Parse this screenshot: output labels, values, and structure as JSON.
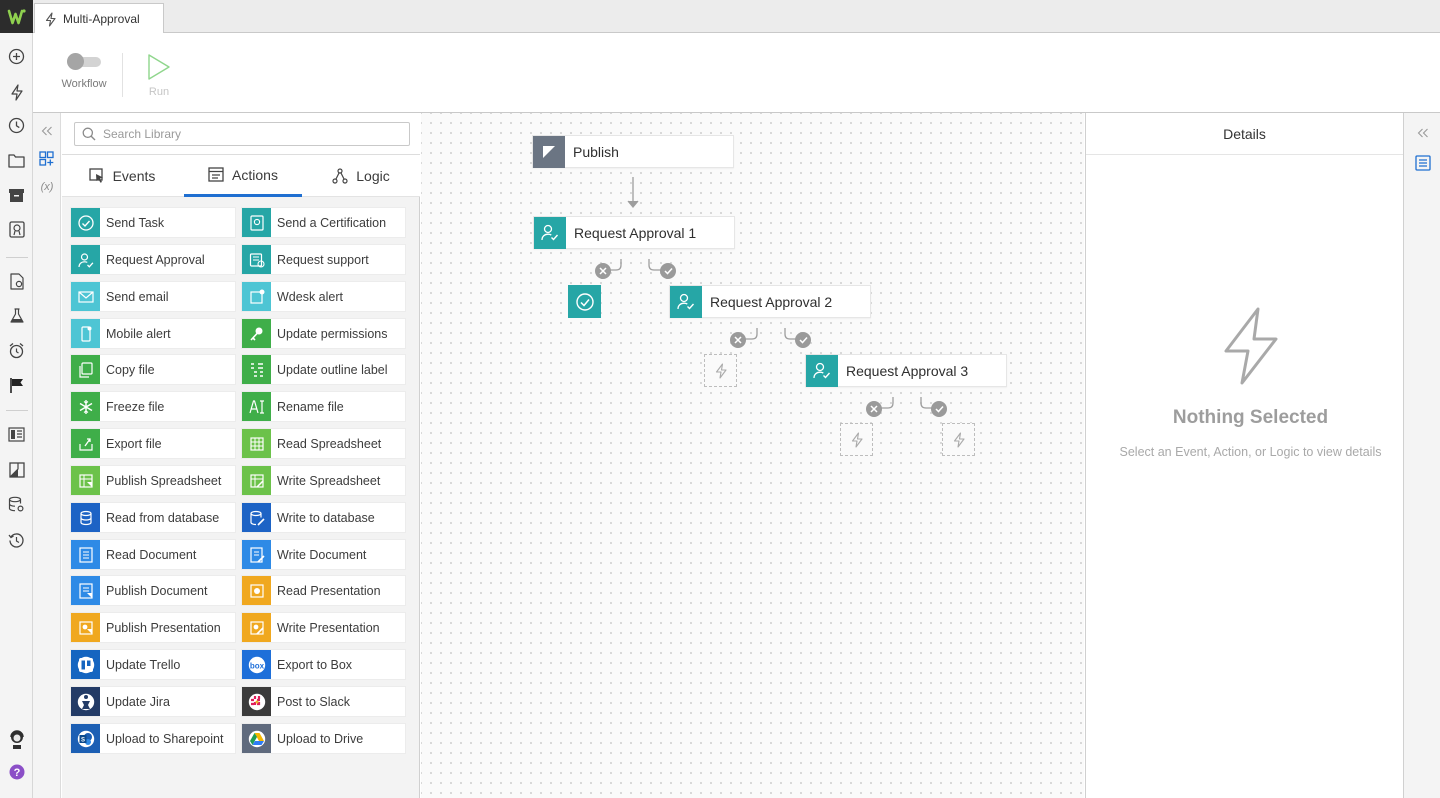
{
  "tab": {
    "title": "Multi-Approval",
    "icon": "lightning-icon"
  },
  "toolbar": {
    "workflow_label": "Workflow",
    "run_label": "Run"
  },
  "library": {
    "search_placeholder": "Search Library",
    "tabs": [
      {
        "label": "Events",
        "icon": "event-cursor-icon"
      },
      {
        "label": "Actions",
        "icon": "actions-icon",
        "active": true
      },
      {
        "label": "Logic",
        "icon": "logic-icon"
      }
    ],
    "items": [
      {
        "label": "Send Task",
        "color": "#26a6a6",
        "icon": "check-circle-icon"
      },
      {
        "label": "Send a Certification",
        "color": "#26a6a6",
        "icon": "certification-icon"
      },
      {
        "label": "Request Approval",
        "color": "#26a6a6",
        "icon": "user-check-icon"
      },
      {
        "label": "Request support",
        "color": "#26a6a6",
        "icon": "support-icon"
      },
      {
        "label": "Send email",
        "color": "#4ec5d4",
        "icon": "email-icon"
      },
      {
        "label": "Wdesk alert",
        "color": "#4ec5d4",
        "icon": "alert-icon"
      },
      {
        "label": "Mobile alert",
        "color": "#4ec5d4",
        "icon": "mobile-icon"
      },
      {
        "label": "Update permissions",
        "color": "#3fae49",
        "icon": "key-icon"
      },
      {
        "label": "Copy file",
        "color": "#3fae49",
        "icon": "copy-icon"
      },
      {
        "label": "Update outline label",
        "color": "#3fae49",
        "icon": "outline-icon"
      },
      {
        "label": "Freeze file",
        "color": "#3fae49",
        "icon": "snowflake-icon"
      },
      {
        "label": "Rename file",
        "color": "#3fae49",
        "icon": "rename-icon"
      },
      {
        "label": "Export file",
        "color": "#3fae49",
        "icon": "export-icon"
      },
      {
        "label": "Read Spreadsheet",
        "color": "#6cc24a",
        "icon": "spreadsheet-icon"
      },
      {
        "label": "Publish Spreadsheet",
        "color": "#6cc24a",
        "icon": "publish-spreadsheet-icon"
      },
      {
        "label": "Write Spreadsheet",
        "color": "#6cc24a",
        "icon": "write-spreadsheet-icon"
      },
      {
        "label": "Read from database",
        "color": "#1d63c5",
        "icon": "database-icon"
      },
      {
        "label": "Write to database",
        "color": "#1d63c5",
        "icon": "write-database-icon"
      },
      {
        "label": "Read Document",
        "color": "#2e8ae6",
        "icon": "document-icon"
      },
      {
        "label": "Write Document",
        "color": "#2e8ae6",
        "icon": "write-document-icon"
      },
      {
        "label": "Publish Document",
        "color": "#2e8ae6",
        "icon": "publish-document-icon"
      },
      {
        "label": "Read Presentation",
        "color": "#f0a81f",
        "icon": "presentation-icon"
      },
      {
        "label": "Publish Presentation",
        "color": "#f0a81f",
        "icon": "publish-presentation-icon"
      },
      {
        "label": "Write Presentation",
        "color": "#f0a81f",
        "icon": "write-presentation-icon"
      },
      {
        "label": "Update Trello",
        "color": "#1565c0",
        "icon": "trello-icon"
      },
      {
        "label": "Export to Box",
        "color": "#1e6fd9",
        "icon": "box-icon"
      },
      {
        "label": "Update Jira",
        "color": "#233b66",
        "icon": "jira-icon"
      },
      {
        "label": "Post to Slack",
        "color": "#3b3b3b",
        "icon": "slack-icon"
      },
      {
        "label": "Upload to Sharepoint",
        "color": "#1c5fb4",
        "icon": "sharepoint-icon"
      },
      {
        "label": "Upload to Drive",
        "color": "#5f6a7d",
        "icon": "drive-icon"
      }
    ]
  },
  "canvas": {
    "nodes": [
      {
        "id": "publish",
        "label": "Publish",
        "color": "#6b7583",
        "icon": "publish-flag-icon"
      },
      {
        "id": "ra1",
        "label": "Request Approval 1",
        "color": "#26a6a6",
        "icon": "user-check-icon"
      },
      {
        "id": "ra2",
        "label": "Request Approval 2",
        "color": "#26a6a6",
        "icon": "user-check-icon"
      },
      {
        "id": "ra3",
        "label": "Request Approval 3",
        "color": "#26a6a6",
        "icon": "user-check-icon"
      }
    ]
  },
  "details": {
    "title": "Details",
    "empty_title": "Nothing Selected",
    "empty_subtitle": "Select an Event, Action, or Logic to view details"
  },
  "colors": {
    "accent_blue": "#1f6fd1",
    "teal": "#26a6a6",
    "branch_grey": "#9a9a9a"
  }
}
